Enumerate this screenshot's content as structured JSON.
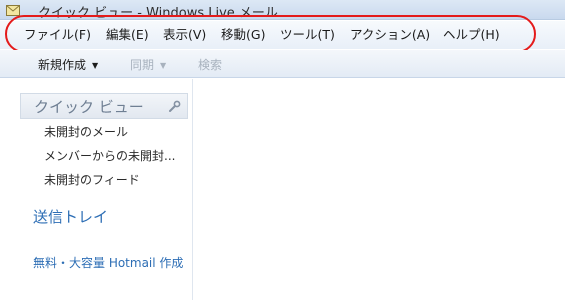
{
  "window": {
    "title": "クイック ビュー - Windows Live メール"
  },
  "menubar": {
    "items": [
      {
        "label": "ファイル(F)"
      },
      {
        "label": "編集(E)"
      },
      {
        "label": "表示(V)"
      },
      {
        "label": "移動(G)"
      },
      {
        "label": "ツール(T)"
      },
      {
        "label": "アクション(A)"
      },
      {
        "label": "ヘルプ(H)"
      }
    ],
    "highlight_color": "#e41b1b"
  },
  "toolbar": {
    "new_label": "新規作成",
    "sync_label": "同期",
    "search_label": "検索",
    "dropdown_glyph": "▼",
    "disabled_color": "#a8b2be"
  },
  "sidebar": {
    "quick_view_title": "クイック ビュー",
    "quick_view_items": [
      {
        "label": "未開封のメール"
      },
      {
        "label": "メンバーからの未開封..."
      },
      {
        "label": "未開封のフィード"
      }
    ],
    "outbox_label": "送信トレイ",
    "promo_link": "無料・大容量 Hotmail 作成",
    "link_color": "#2d6eb5"
  }
}
